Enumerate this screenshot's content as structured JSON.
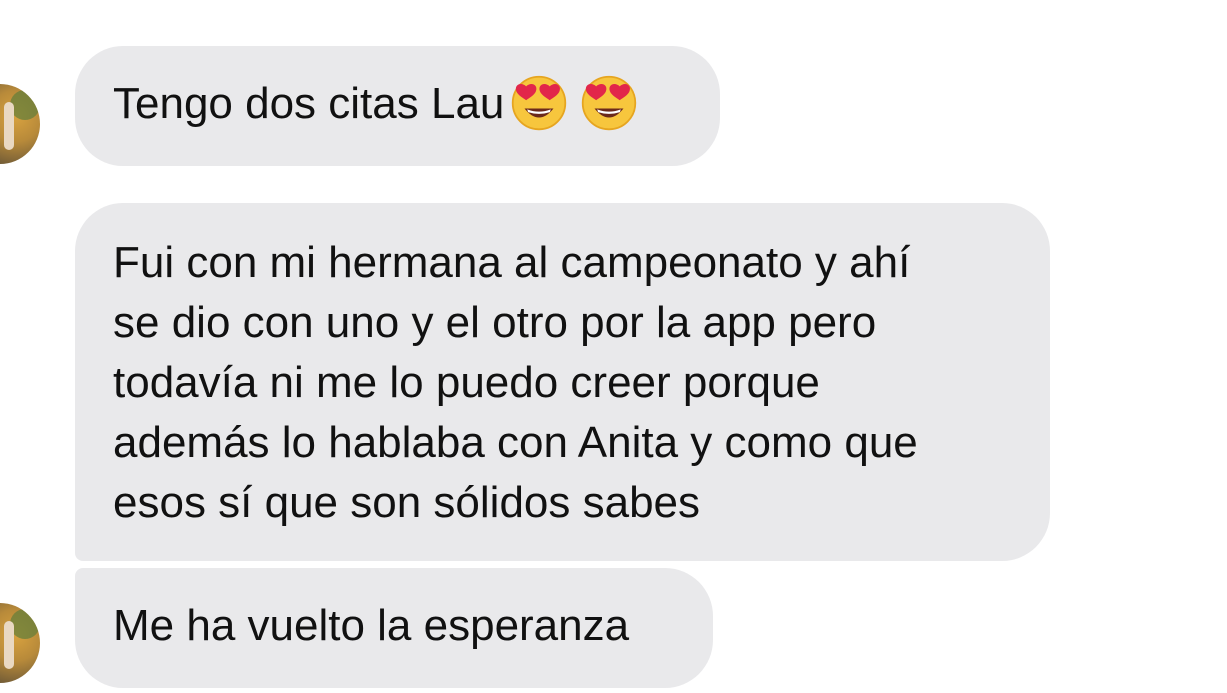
{
  "messages": [
    {
      "text": "Tengo dos citas Lau",
      "emojis": [
        "heart-eyes-emoji",
        "heart-eyes-emoji"
      ]
    },
    {
      "lines": [
        "Fui con mi hermana al campeonato y ahí",
        "se dio con uno y el otro por la app pero",
        "todavía ni me lo puedo creer porque",
        "además lo hablaba con Anita y como que",
        "esos sí que son sólidos sabes"
      ]
    },
    {
      "text": "Me ha vuelto la esperanza"
    }
  ],
  "colors": {
    "bubble_background": "#e9e9eb",
    "text": "#111111",
    "background": "#ffffff"
  }
}
